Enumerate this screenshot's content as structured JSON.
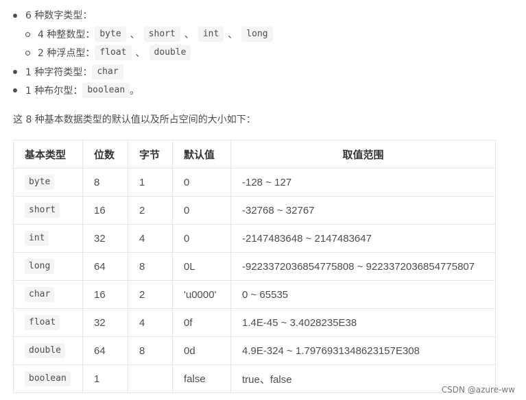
{
  "list": {
    "l1": "6 种数字类型：",
    "l2_prefix": "4 种整数型：",
    "l2_items": [
      "byte",
      "short",
      "int",
      "long"
    ],
    "l3_prefix": "2 种浮点型：",
    "l3_items": [
      "float",
      "double"
    ],
    "l4_prefix": "1 种字符类型：",
    "l4_item": "char",
    "l5_prefix": "1 种布尔型：",
    "l5_item": "boolean",
    "l5_suffix": "。",
    "sep": "、"
  },
  "intro": "这 8 种基本数据类型的默认值以及所占空间的大小如下：",
  "table": {
    "headers": [
      "基本类型",
      "位数",
      "字节",
      "默认值",
      "取值范围"
    ],
    "rows": [
      [
        "byte",
        "8",
        "1",
        "0",
        "-128 ~ 127"
      ],
      [
        "short",
        "16",
        "2",
        "0",
        "-32768 ~ 32767"
      ],
      [
        "int",
        "32",
        "4",
        "0",
        "-2147483648 ~ 2147483647"
      ],
      [
        "long",
        "64",
        "8",
        "0L",
        "-9223372036854775808 ~ 9223372036854775807"
      ],
      [
        "char",
        "16",
        "2",
        "'u0000'",
        "0 ~ 65535"
      ],
      [
        "float",
        "32",
        "4",
        "0f",
        "1.4E-45 ~ 3.4028235E38"
      ],
      [
        "double",
        "64",
        "8",
        "0d",
        "4.9E-324 ~ 1.7976931348623157E308"
      ],
      [
        "boolean",
        "1",
        "",
        "false",
        "true、false"
      ]
    ]
  },
  "watermark": "CSDN @azure-ww"
}
